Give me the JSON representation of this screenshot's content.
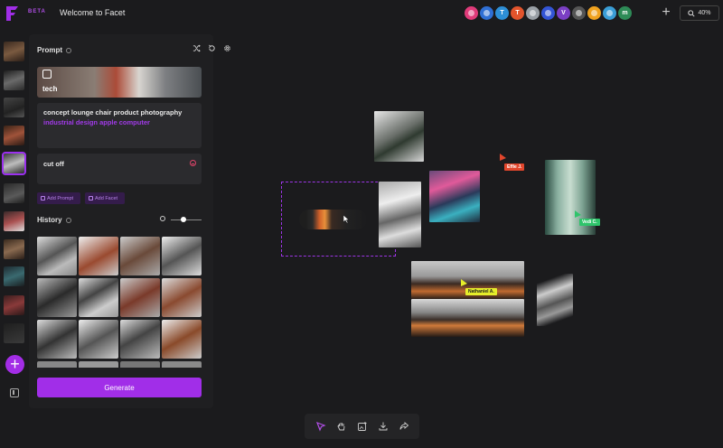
{
  "app": {
    "beta_label": "BETA",
    "title": "Welcome to Facet",
    "brand_color": "#a12ee8"
  },
  "collaborators": [
    {
      "initial": "",
      "color": "#e03b7a",
      "icon": "avatar-pink"
    },
    {
      "initial": "",
      "color": "#2f6fd4",
      "icon": "avatar-cartoon"
    },
    {
      "initial": "T",
      "color": "#2d8fd6"
    },
    {
      "initial": "T",
      "color": "#e2542c"
    },
    {
      "initial": "",
      "color": "#9aa0a6",
      "icon": "avatar-photo"
    },
    {
      "initial": "",
      "color": "#3355d6",
      "icon": "avatar-pattern"
    },
    {
      "initial": "V",
      "color": "#7b3fc4"
    },
    {
      "initial": "",
      "color": "#555555",
      "icon": "avatar-photo"
    },
    {
      "initial": "",
      "color": "#f0a21f",
      "icon": "avatar-cartoon"
    },
    {
      "initial": "",
      "color": "#3a9ed6",
      "icon": "avatar-photo"
    },
    {
      "initial": "m",
      "color": "#2e8b57"
    }
  ],
  "zoom": {
    "label": "40%"
  },
  "prompt_section": {
    "title": "Prompt",
    "style_card": {
      "label": "tech"
    },
    "prompt_text_plain": "concept lounge chair product photography ",
    "prompt_text_highlight": "industrial design apple computer",
    "negative_text": "cut off",
    "add_prompt_label": "Add Prompt",
    "add_facet_label": "Add Facet"
  },
  "history_section": {
    "title": "History"
  },
  "generate_label": "Generate",
  "cursor_tags": [
    {
      "name": "Effie J.",
      "bg": "#e2462c",
      "fg": "#ffffff"
    },
    {
      "name": "Vedi C.",
      "bg": "#2fc46b",
      "fg": "#ffffff"
    },
    {
      "name": "Nathaniel A.",
      "bg": "#e6ee2a",
      "fg": "#1b1b1d"
    }
  ]
}
